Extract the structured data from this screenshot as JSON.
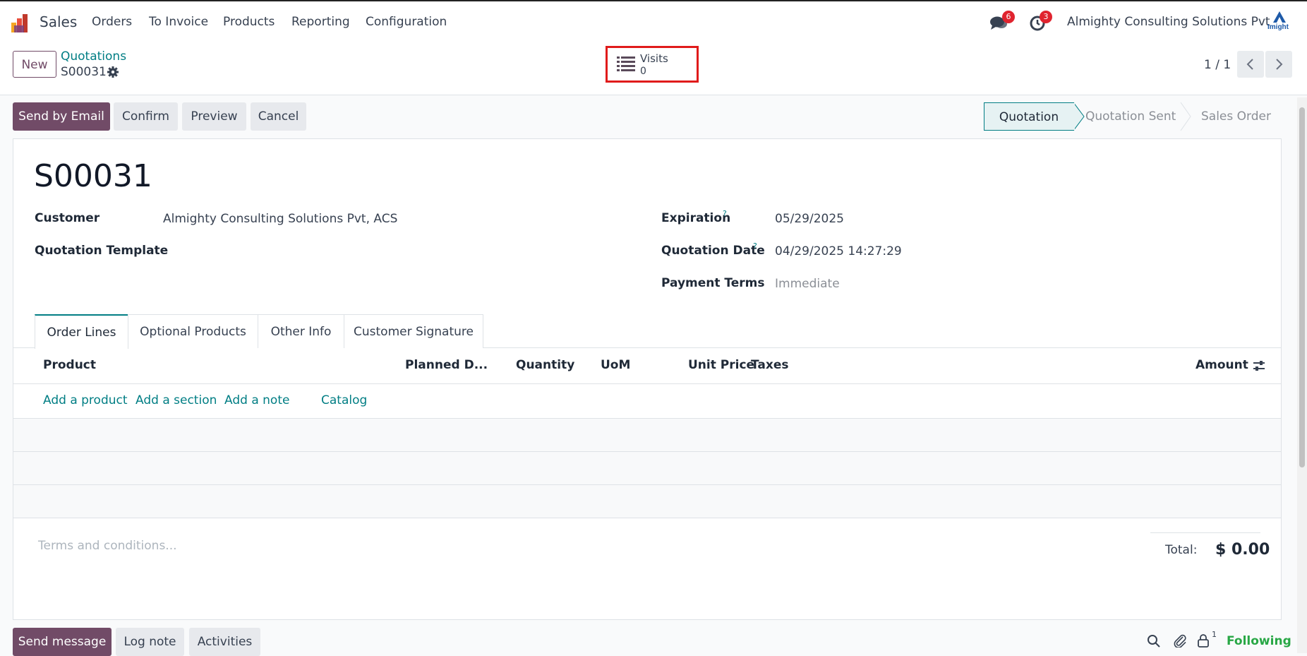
{
  "nav": {
    "app_name": "Sales",
    "items": [
      "Orders",
      "To Invoice",
      "Products",
      "Reporting",
      "Configuration"
    ],
    "messages_badge": "6",
    "activities_badge": "3",
    "company": "Almighty Consulting Solutions Pvt",
    "avatar_text": "Imight"
  },
  "control": {
    "new_label": "New",
    "breadcrumb": "Quotations",
    "record": "S00031",
    "visits_label": "Visits",
    "visits_count": "0",
    "pager": "1 / 1"
  },
  "actions": {
    "send_email": "Send by Email",
    "confirm": "Confirm",
    "preview": "Preview",
    "cancel": "Cancel"
  },
  "statusbar": [
    "Quotation",
    "Quotation Sent",
    "Sales Order"
  ],
  "form": {
    "title": "S00031",
    "customer_label": "Customer",
    "customer_value": "Almighty Consulting Solutions Pvt, ACS",
    "template_label": "Quotation Template",
    "expiration_label": "Expiration",
    "expiration_value": "05/29/2025",
    "qdate_label": "Quotation Date",
    "qdate_value": "04/29/2025 14:27:29",
    "terms_label": "Payment Terms",
    "terms_value": "Immediate",
    "help_mark": "?"
  },
  "tabs": [
    "Order Lines",
    "Optional Products",
    "Other Info",
    "Customer Signature"
  ],
  "table": {
    "headers": [
      "Product",
      "Planned D...",
      "Quantity",
      "UoM",
      "Unit Price",
      "Taxes",
      "Amount"
    ],
    "add_links": [
      "Add a product",
      "Add a section",
      "Add a note",
      "Catalog"
    ]
  },
  "footer": {
    "terms_placeholder": "Terms and conditions...",
    "total_label": "Total:",
    "total_value": "$ 0.00"
  },
  "chatter": {
    "send_message": "Send message",
    "log_note": "Log note",
    "activities": "Activities",
    "followers_count": "1",
    "following": "Following"
  },
  "colors": {
    "brand": "#714b67",
    "accent": "#017e84",
    "highlight": "#e01b1b"
  }
}
